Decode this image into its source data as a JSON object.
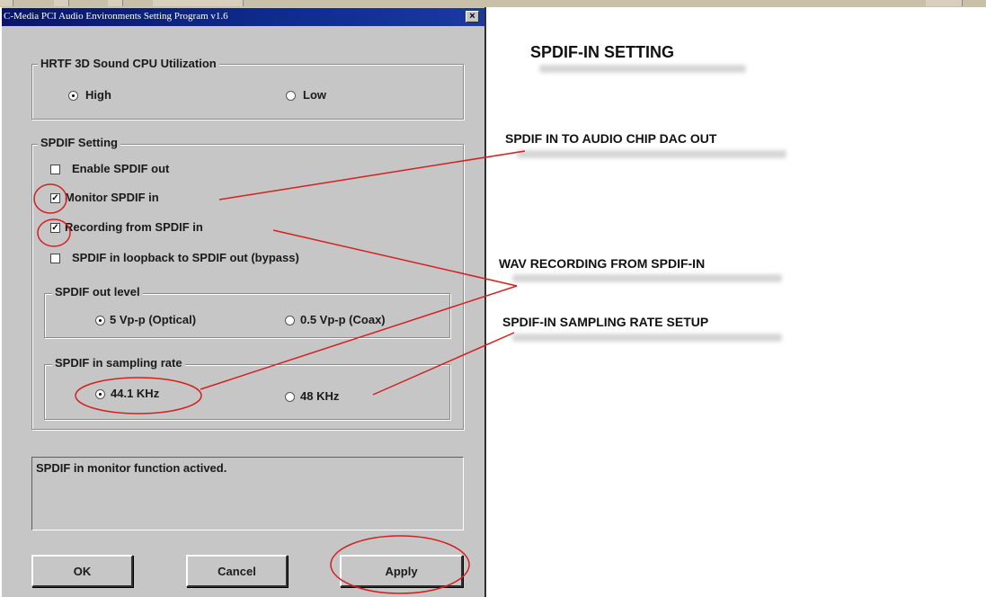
{
  "dialog": {
    "title": "C-Media PCI Audio Environments Setting Program v1.6",
    "close_glyph": "×",
    "hrtf_group": {
      "legend": "HRTF 3D Sound CPU Utilization",
      "options": [
        {
          "label": "High",
          "selected": true
        },
        {
          "label": "Low",
          "selected": false
        }
      ]
    },
    "spdif_group": {
      "legend": "SPDIF Setting",
      "checkboxes": [
        {
          "label": "Enable SPDIF out",
          "checked": false
        },
        {
          "label": "Monitor SPDIF in",
          "checked": true
        },
        {
          "label": "Recording from SPDIF in",
          "checked": true
        },
        {
          "label": "SPDIF in loopback to SPDIF out (bypass)",
          "checked": false
        }
      ],
      "out_level": {
        "legend": "SPDIF out level",
        "options": [
          {
            "label": "5 Vp-p (Optical)",
            "selected": true
          },
          {
            "label": "0.5 Vp-p (Coax)",
            "selected": false
          }
        ]
      },
      "sampling_rate": {
        "legend": "SPDIF in sampling rate",
        "options": [
          {
            "label": "44.1 KHz",
            "selected": true
          },
          {
            "label": "48 KHz",
            "selected": false
          }
        ]
      }
    },
    "status_text": "SPDIF in monitor function actived.",
    "buttons": {
      "ok": "OK",
      "cancel": "Cancel",
      "apply": "Apply"
    }
  },
  "annotations": {
    "heading": "SPDIF-IN SETTING",
    "monitor_note": "SPDIF IN TO AUDIO CHIP DAC OUT",
    "recording_note": "WAV RECORDING FROM SPDIF-IN",
    "sampling_note": "SPDIF-IN SAMPLING RATE SETUP"
  },
  "colors": {
    "titlebar": "#0f2c8e",
    "dialog_face": "#c6c6c6",
    "annotation_red": "#d42020"
  }
}
